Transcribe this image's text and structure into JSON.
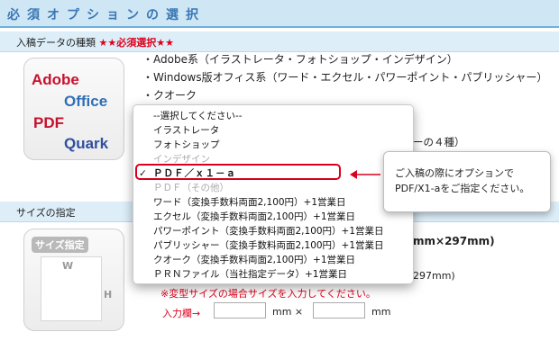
{
  "header": {
    "title": "必須オプションの選択"
  },
  "file_type": {
    "label": "入稿データの種類",
    "required": "★★必須選択★★",
    "logo": {
      "adobe": "Adobe",
      "office": "Office",
      "pdf": "PDF",
      "quark": "Quark"
    },
    "bullets": [
      "・Adobe系（イラストレータ・フォトショップ・インデザイン）",
      "・Windows版オフィス系（ワード・エクセル・パワーポイント・パブリッシャー）",
      "・クオーク"
    ],
    "behind_text": [
      "ーの４種）"
    ],
    "dropdown": {
      "options": [
        "--選択してください--",
        "イラストレータ",
        "フォトショップ",
        "インデザイン",
        "ＰＤＦ／ｘ１－ａ",
        "ＰＤＦ（その他）",
        "ワード（変換手数料両面2,100円）+1営業日",
        "エクセル（変換手数料両面2,100円）+1営業日",
        "パワーポイント（変換手数料両面2,100円）+1営業日",
        "パブリッシャー（変換手数料両面2,100円）+1営業日",
        "クオーク（変換手数料両面2,100円）+1営業日",
        "ＰＲＮファイル（当社指定データ）+1営業日"
      ],
      "selected_index": 4,
      "disabled_indexes": [
        3,
        5
      ],
      "check": "✓"
    },
    "tooltip": "ご入稿の際にオプションでPDF/X1-aをご指定ください。",
    "arrow": "←"
  },
  "size": {
    "label": "サイズの指定",
    "image_title": "サイズ指定",
    "w": "W",
    "h": "H",
    "behind_text": [
      "mm×297mm)",
      "297mm)"
    ],
    "note": "※変型サイズの場合サイズを入力してください。",
    "input_label": "入力欄→",
    "unit1": "mm ×",
    "unit2": "mm"
  },
  "colors": {
    "accent": "#3a77b5",
    "required": "#e0001b",
    "band": "#ddeef9"
  }
}
